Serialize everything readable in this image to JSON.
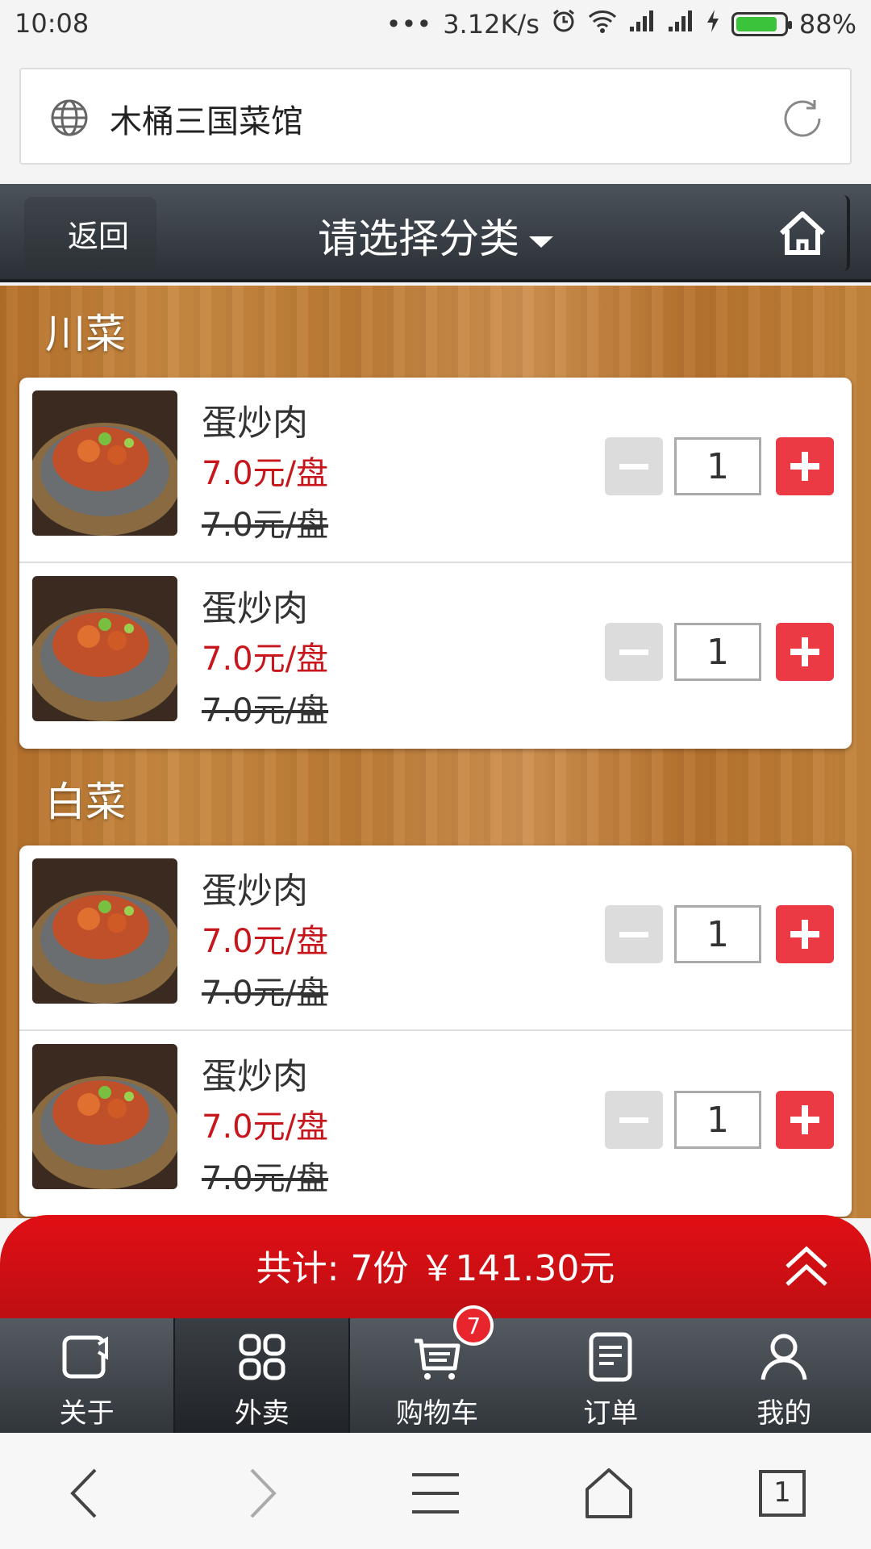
{
  "status": {
    "time": "10:08",
    "dots": "•••",
    "speed": "3.12K/s",
    "battery": "88%",
    "battery_level": 0.88
  },
  "browser": {
    "page_title": "木桶三国菜馆",
    "tab_count": "1"
  },
  "header": {
    "back_label": "返回",
    "category_label": "请选择分类"
  },
  "sections": [
    {
      "title": "川菜",
      "items": [
        {
          "name": "蛋炒肉",
          "price": "7.0元/盘",
          "old_price": "7.0元/盘",
          "qty": "1"
        },
        {
          "name": "蛋炒肉",
          "price": "7.0元/盘",
          "old_price": "7.0元/盘",
          "qty": "1"
        }
      ]
    },
    {
      "title": "白菜",
      "items": [
        {
          "name": "蛋炒肉",
          "price": "7.0元/盘",
          "old_price": "7.0元/盘",
          "qty": "1"
        },
        {
          "name": "蛋炒肉",
          "price": "7.0元/盘",
          "old_price": "7.0元/盘",
          "qty": "1"
        }
      ]
    }
  ],
  "total": {
    "text": "共计: 7份 ￥141.30元"
  },
  "tabs": [
    {
      "label": "关于",
      "icon": "about-icon"
    },
    {
      "label": "外卖",
      "icon": "grid-icon"
    },
    {
      "label": "购物车",
      "icon": "cart-icon",
      "badge": "7"
    },
    {
      "label": "订单",
      "icon": "order-icon"
    },
    {
      "label": "我的",
      "icon": "user-icon"
    }
  ],
  "colors": {
    "accent_red": "#c8161d",
    "plus_button": "#ec3a45",
    "total_bar": "#d00f14",
    "header": "#3a4047"
  }
}
